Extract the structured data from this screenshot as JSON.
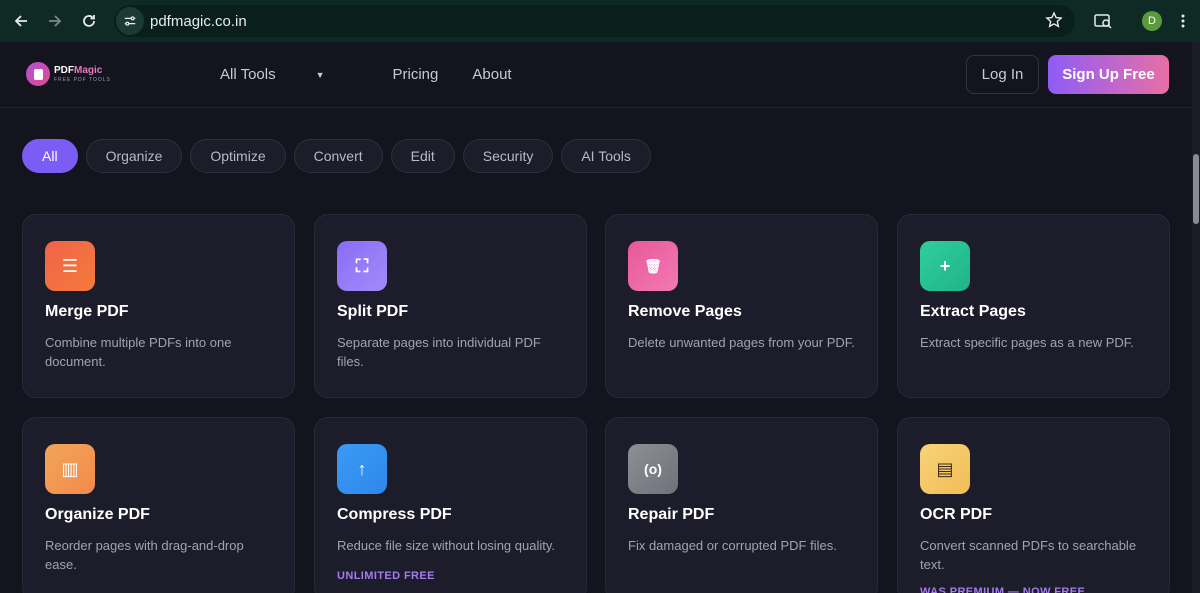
{
  "browser": {
    "url": "pdfmagic.co.in",
    "profile_initial": "D"
  },
  "header": {
    "logo_title_a": "PDF",
    "logo_title_b": "Magic",
    "logo_sub": "FREE PDF TOOLS",
    "nav": [
      "All Tools",
      "Pricing",
      "About"
    ],
    "login": "Log In",
    "signup": "Sign Up Free"
  },
  "filters": [
    "All",
    "Organize",
    "Optimize",
    "Convert",
    "Edit",
    "Security",
    "AI Tools"
  ],
  "tools": [
    {
      "title": "Merge PDF",
      "desc": "Combine multiple PDFs into one document.",
      "icon": "list-icon",
      "color_a": "#f0634a",
      "color_b": "#f47b3a",
      "glyph": "☰"
    },
    {
      "title": "Split PDF",
      "desc": "Separate pages into individual PDF files.",
      "icon": "split-icon",
      "color_a": "#8a6cf7",
      "color_b": "#a38bf8",
      "glyph": "⛶"
    },
    {
      "title": "Remove Pages",
      "desc": "Delete unwanted pages from your PDF.",
      "icon": "trash-icon",
      "color_a": "#e8579a",
      "color_b": "#f27ab3",
      "glyph": "🗑"
    },
    {
      "title": "Extract Pages",
      "desc": "Extract specific pages as a new PDF.",
      "icon": "file-plus-icon",
      "color_a": "#2fcf9c",
      "color_b": "#1fb38a",
      "glyph": "+"
    },
    {
      "title": "Organize PDF",
      "desc": "Reorder pages with drag-and-drop ease.",
      "icon": "columns-icon",
      "color_a": "#f2a55a",
      "color_b": "#f28a4a",
      "glyph": "▥"
    },
    {
      "title": "Compress PDF",
      "desc": "Reduce file size without losing quality.",
      "icon": "arrow-up-icon",
      "color_a": "#3a9bf5",
      "color_b": "#2f86ea",
      "glyph": "↑",
      "badge": "UNLIMITED FREE"
    },
    {
      "title": "Repair PDF",
      "desc": "Fix damaged or corrupted PDF files.",
      "icon": "repair-icon",
      "color_a": "#8c8f96",
      "color_b": "#6f7279",
      "glyph": "(o)"
    },
    {
      "title": "OCR PDF",
      "desc": "Convert scanned PDFs to searchable text.",
      "icon": "document-text-icon",
      "color_a": "#f7d27a",
      "color_b": "#f2bd55",
      "glyph": "▤",
      "badge": "WAS PREMIUM — NOW FREE"
    }
  ]
}
